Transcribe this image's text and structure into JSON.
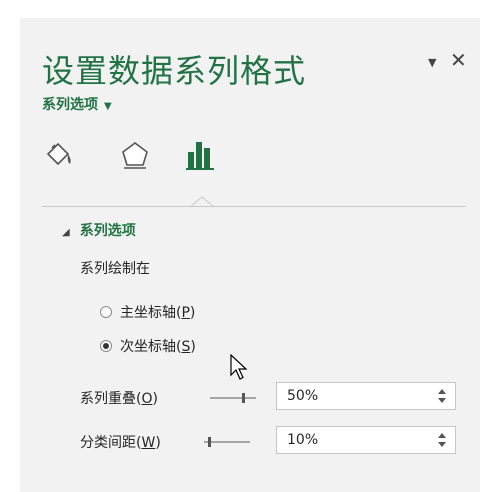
{
  "pane": {
    "title": "设置数据系列格式",
    "menu_glyph": "▼",
    "close_glyph": "✕",
    "subtitle": "系列选项",
    "subtitle_caret": "▼"
  },
  "tabs": [
    {
      "name": "fill-line-icon"
    },
    {
      "name": "effects-icon"
    },
    {
      "name": "series-options-icon"
    }
  ],
  "section": {
    "title": "系列选项",
    "collapse_glyph": "◢",
    "plot_on_label": "系列绘制在",
    "primary_axis": {
      "text": "主坐标轴(",
      "key": "P",
      "close": ")"
    },
    "secondary_axis": {
      "text": "次坐标轴(",
      "key": "S",
      "close": ")",
      "selected": true
    },
    "overlap": {
      "text": "系列重叠(",
      "key": "O",
      "close": ")",
      "value": "50%"
    },
    "gap": {
      "text": "分类间距(",
      "key": "W",
      "close": ")",
      "value": "10%"
    }
  },
  "colors": {
    "accent": "#217346",
    "pane_bg": "#f2f2f2"
  }
}
